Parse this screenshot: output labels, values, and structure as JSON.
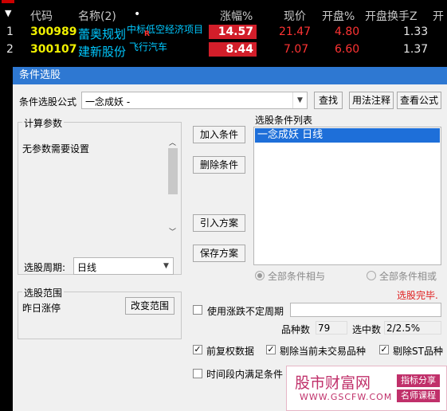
{
  "stock_table": {
    "headers": {
      "code": "代码",
      "name": "名称(2)",
      "dot": "•",
      "change": "涨幅%",
      "price": "现价",
      "open": "开盘%",
      "turnover": "开盘换手Z",
      "extra": "开"
    },
    "rows": [
      {
        "idx": "1",
        "code": "300989",
        "name": "蕾奥规划",
        "tag": "中标低空经济项目",
        "mark": "R",
        "change": "14.57",
        "price": "21.47",
        "open": "4.80",
        "turnover": "1.33"
      },
      {
        "idx": "2",
        "code": "300107",
        "name": "建新股份",
        "tag": "飞行汽车",
        "change": "8.44",
        "price": "7.07",
        "open": "6.60",
        "turnover": "1.37"
      }
    ]
  },
  "dialog": {
    "title": "条件选股",
    "formula_label": "条件选股公式",
    "formula_value": "一念成妖  -",
    "btn_find": "查找",
    "btn_usage": "用法注释",
    "btn_view": "查看公式",
    "params_title": "计算参数",
    "params_text": "无参数需要设置",
    "period_label": "选股周期:",
    "period_value": "日线",
    "btn_add": "加入条件",
    "btn_delete": "删除条件",
    "btn_import": "引入方案",
    "btn_save": "保存方案",
    "conditions_title": "选股条件列表",
    "conditions": [
      "一念成妖  日线"
    ],
    "radio_and": "全部条件相与",
    "radio_or": "全部条件相或",
    "status": "选股完毕.",
    "range_title": "选股范围",
    "range_value": "昨日涨停",
    "btn_range": "改变范围",
    "use_variable_period": "使用涨跌不定周期",
    "count_label": "品种数",
    "count_value": "79",
    "selected_label": "选中数",
    "selected_value": "2/2.5%",
    "opt_adjust": "前复权数据",
    "opt_exclude_untraded": "剔除当前未交易品种",
    "opt_exclude_st": "剔除ST品种",
    "opt_time_range": "时间段内满足条件"
  },
  "watermark": {
    "site": "股市财富网",
    "url": "WWW.GSCFW.COM",
    "tag1": "指标分享",
    "tag2": "名师课程"
  },
  "colors": {
    "title_bar": "#2e78d2",
    "list_selected": "#1e6fd9",
    "up_red": "#d21e2a"
  }
}
